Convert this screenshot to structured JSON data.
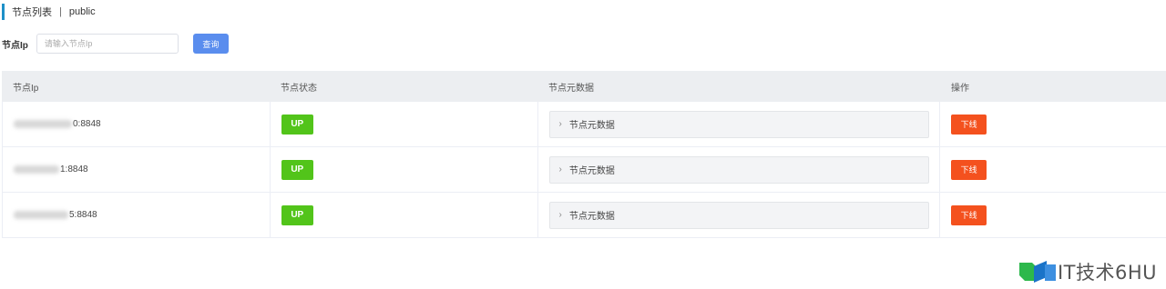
{
  "breadcrumb": {
    "title": "节点列表",
    "separator": "|",
    "namespace": "public"
  },
  "search": {
    "label": "节点Ip",
    "placeholder": "请输入节点Ip",
    "button_label": "查询"
  },
  "table": {
    "headers": [
      "节点Ip",
      "节点状态",
      "节点元数据",
      "操作"
    ],
    "rows": [
      {
        "ip_visible": "0:8848",
        "status": "UP",
        "metadata_label": "节点元数据",
        "action": "下线"
      },
      {
        "ip_visible": "1:8848",
        "status": "UP",
        "metadata_label": "节点元数据",
        "action": "下线"
      },
      {
        "ip_visible": "5:8848",
        "status": "UP",
        "metadata_label": "节点元数据",
        "action": "下线"
      }
    ]
  },
  "icons": {
    "chevron": "chevron-right-icon"
  },
  "colors": {
    "accent": "#1e90c8",
    "primary_button": "#5a8dee",
    "status_up": "#52c41a",
    "danger": "#f4511e",
    "header_bg": "#eceef1"
  },
  "watermark": {
    "text": "IT技术6HU"
  }
}
